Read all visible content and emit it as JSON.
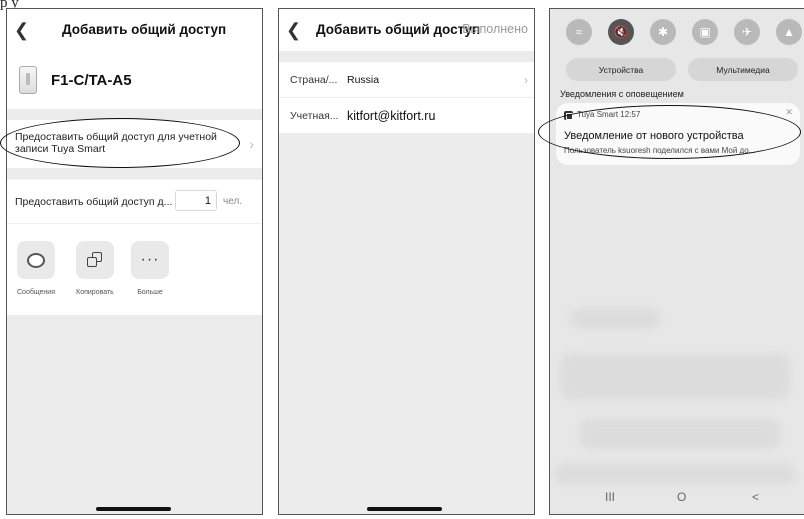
{
  "page_top_text": "р у",
  "phone1": {
    "header": {
      "back_icon": "chevron-left-icon",
      "title": "Добавить общий доступ"
    },
    "device": {
      "name": "F1-C/TA-A5"
    },
    "share_account": {
      "text": "Предоставить общий доступ для учетной записи Tuya Smart"
    },
    "share_count": {
      "label": "Предоставить общий доступ д...",
      "value": "1",
      "unit": "чел."
    },
    "actions": [
      {
        "label": "Сообщения",
        "icon": "message-icon"
      },
      {
        "label": "Копировать",
        "icon": "copy-icon"
      },
      {
        "label": "Больше",
        "icon": "more-icon"
      }
    ]
  },
  "phone2": {
    "header": {
      "back_icon": "chevron-left-icon",
      "title": "Добавить общий доступ",
      "done": "Выполнено"
    },
    "fields": [
      {
        "label": "Страна/...",
        "value": "Russia"
      },
      {
        "label": "Учетная...",
        "value": "kitfort@kitfort.ru"
      }
    ]
  },
  "phone3": {
    "quick_settings": [
      "wifi-icon",
      "mute-icon",
      "bluetooth-icon",
      "portrait-lock-icon",
      "airplane-mode-icon",
      "flashlight-icon"
    ],
    "tabs": {
      "devices": "Устройства",
      "media": "Мультимедиа"
    },
    "notifications_header": "Уведомления с оповещением",
    "notification": {
      "app": "Tuya Smart",
      "time": "12:57",
      "title": "Уведомление от нового устройства",
      "body": "Пользователь ksuoresh поделился с вами Мой до..."
    },
    "nav": {
      "recent": "III",
      "home": "O",
      "back": "<"
    }
  }
}
